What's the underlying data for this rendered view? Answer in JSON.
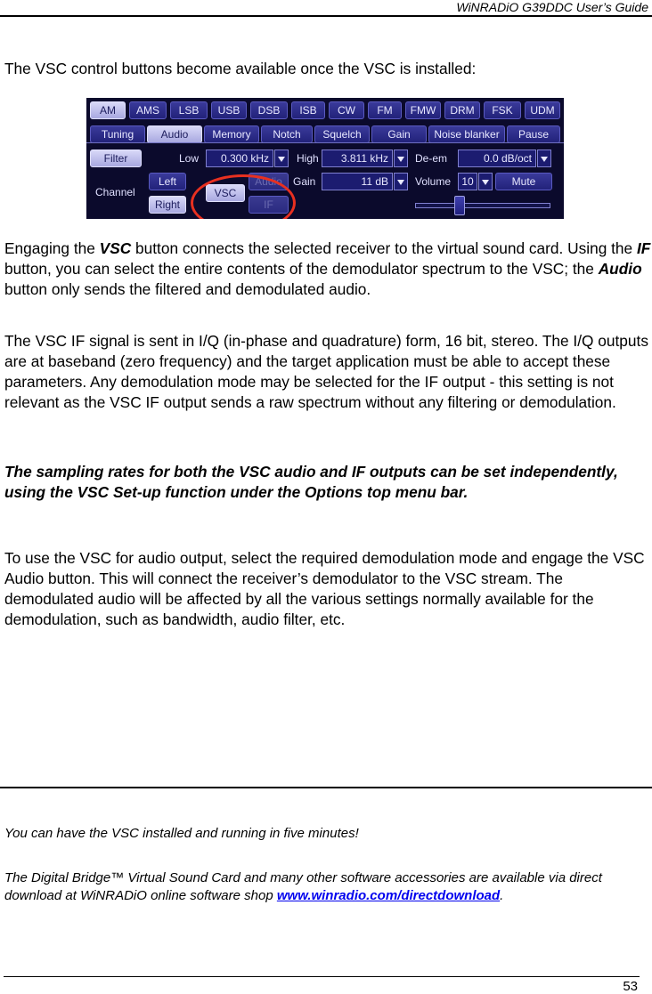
{
  "header": {
    "title": "WiNRADiO G39DDC User’s Guide"
  },
  "intro": "The VSC control buttons become available once the VSC is installed:",
  "screenshot": {
    "mode_buttons": [
      {
        "label": "AM",
        "selected": true
      },
      {
        "label": "AMS"
      },
      {
        "label": "LSB"
      },
      {
        "label": "USB"
      },
      {
        "label": "DSB"
      },
      {
        "label": "ISB"
      },
      {
        "label": "CW"
      },
      {
        "label": "FM"
      },
      {
        "label": "FMW"
      },
      {
        "label": "DRM"
      },
      {
        "label": "FSK"
      },
      {
        "label": "UDM"
      }
    ],
    "tabs": [
      {
        "label": "Tuning"
      },
      {
        "label": "Audio",
        "selected": true
      },
      {
        "label": "Memory"
      },
      {
        "label": "Notch"
      },
      {
        "label": "Squelch"
      },
      {
        "label": "Gain"
      },
      {
        "label": "Noise blanker"
      },
      {
        "label": "Pause"
      }
    ],
    "filter_button": "Filter",
    "channel_label": "Channel",
    "left_button": "Left",
    "right_button": "Right",
    "vsc_button": "VSC",
    "audio_button": "Audio",
    "if_button": "IF",
    "low_label": "Low",
    "low_value": "0.300 kHz",
    "high_label": "High",
    "high_value": "3.811 kHz",
    "gain_label": "Gain",
    "gain_value": "11 dB",
    "deem_label": "De-em",
    "deem_value": "0.0 dB/oct",
    "volume_label": "Volume",
    "volume_value": "10",
    "mute_button": "Mute",
    "volume_slider_fraction": 0.33,
    "highlight_color": "#e83020"
  },
  "paragraphs": {
    "p1": {
      "a": "Engaging the ",
      "b": "VSC",
      "c": " button connects the selected receiver to the virtual sound card. Using the ",
      "d": "IF",
      "e": " button, you can select the entire contents of the demodulator spectrum to the VSC; the ",
      "f": "Audio",
      "g": " button only sends the filtered and demodulated audio."
    },
    "p2": "The VSC IF signal is sent in I/Q (in-phase and quadrature) form, 16 bit, stereo. The I/Q outputs are at baseband (zero frequency) and the target application must be able to accept these parameters. Any demodulation mode may be selected for the IF output - this setting is not relevant as the VSC IF output sends a raw spectrum without any filtering or demodulation.",
    "p3": "The sampling rates for both the VSC audio and IF outputs can be set independently, using the VSC Set-up function under the Options top menu bar.",
    "p4": "To use the VSC for audio output, select the required demodulation mode and engage the VSC Audio button. This will connect the receiver’s demodulator to the VSC stream. The demodulated audio will be affected by all the various settings normally available for the demodulation, such as bandwidth, audio filter, etc."
  },
  "notes": {
    "n1": "You can have the VSC installed and running in five minutes!",
    "n2": "The Digital Bridge™ Virtual Sound Card and many other software accessories are available via direct download at WiNRADiO online software shop ",
    "link": "www.winradio.com/directdownload",
    "n2_end": "."
  },
  "footer": {
    "page_number": "53"
  }
}
